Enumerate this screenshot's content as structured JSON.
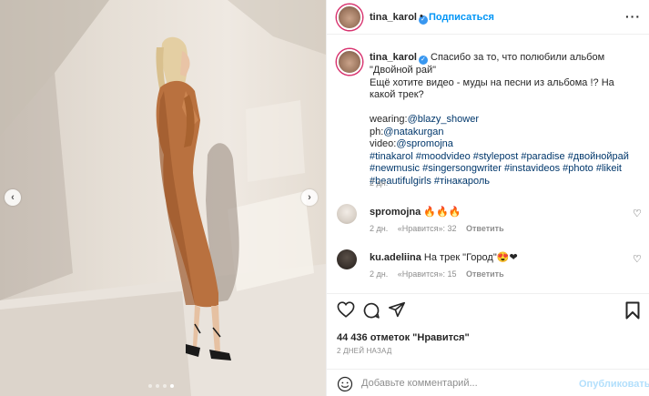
{
  "photo": {
    "prev_icon": "chevron-left",
    "next_icon": "chevron-right",
    "dots_total": 4,
    "active_dot": 4
  },
  "header": {
    "username": "tina_karol",
    "separator": "•",
    "follow_label": "Подписаться",
    "verified_icon": "verified-badge",
    "more_icon": "more-horizontal"
  },
  "caption": {
    "username": "tina_karol",
    "line1": "Спасибо за то, что полюбили альбом \"Двойной рай\"",
    "line2": "Ещё хотите видео - муды на песни из альбома !? На какой трек?",
    "wearing_label": "wearing:",
    "wearing_link": "@blazy_shower",
    "ph_label": "ph:",
    "ph_link": "@natakurgan",
    "video_label": "video:",
    "video_link": "@spromojna",
    "hashtags1": "#tinakarol #moodvideo #stylepost #paradise #двойнойрай",
    "hashtags2": "#newmusic #singersongwriter #instavideos #photo #likeit",
    "hashtags3": "#beautifulgirls #тінакароль",
    "time": "2 дн."
  },
  "comments": [
    {
      "username": "spromojna",
      "text": "🔥🔥🔥",
      "time": "2 дн.",
      "likes": "«Нравится»: 32",
      "reply": "Ответить"
    },
    {
      "username": "ku.adeliina",
      "text": "На трек \"Город\"😍❤",
      "time": "2 дн.",
      "likes": "«Нравится»: 15",
      "reply": "Ответить"
    }
  ],
  "actions": {
    "likes_text": "44 436 отметок \"Нравится\"",
    "date": "2 ДНЕЙ НАЗАД",
    "comment_placeholder": "Добавьте комментарий...",
    "publish_label": "Опубликовать"
  },
  "colors": {
    "accent": "#0095f6",
    "verified": "#3897f0",
    "muted": "#8e8e8e",
    "publish_disabled": "#b2dffc"
  }
}
